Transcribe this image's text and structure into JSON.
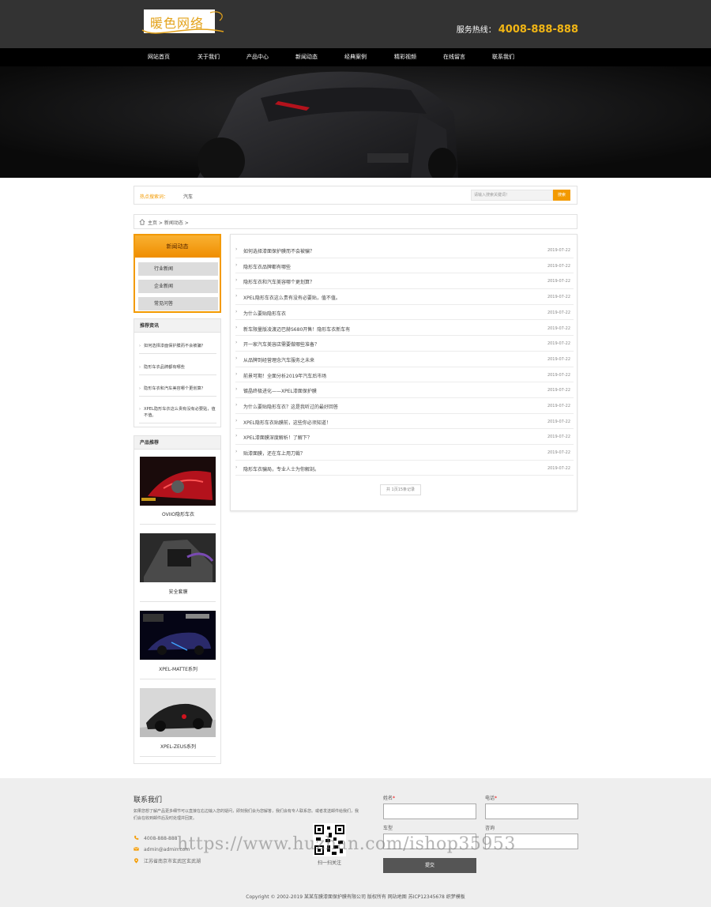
{
  "header": {
    "logo_text": "暖色网络",
    "hotline_label": "服务热线：",
    "hotline_number": "4008-888-888"
  },
  "nav": {
    "items": [
      "网站首页",
      "关于我们",
      "产品中心",
      "新闻动态",
      "经典案例",
      "精彩视频",
      "在线留言",
      "联系我们"
    ]
  },
  "hotsearch": {
    "label": "热点搜索词：",
    "word": "汽车",
    "placeholder": "请输入搜索关键词！",
    "button": "搜索"
  },
  "breadcrumb": {
    "text": "主页 > 新闻动态 >"
  },
  "sidebar": {
    "category_title": "新闻动态",
    "categories": [
      "行业新闻",
      "企业新闻",
      "常见问答"
    ],
    "recommend_title": "推荐资讯",
    "recommend_items": [
      "如何选择漆面保护膜而不会被骗？",
      "隐形车衣品牌都有哪些",
      "隐形车衣和汽车美容哪个更划算？",
      "XPEL隐形车衣这么贵有没有必要贴，值不值。"
    ],
    "product_title": "产品推荐",
    "products": [
      "OVIIO隐形车衣",
      "安全套膜",
      "XPEL-MATTE系列",
      "XPEL-ZEUS系列"
    ]
  },
  "news": {
    "items": [
      {
        "title": "如何选择漆面保护膜而不会被骗？",
        "date": "2019-07-22"
      },
      {
        "title": "隐形车衣品牌都有哪些",
        "date": "2019-07-22"
      },
      {
        "title": "隐形车衣和汽车美容哪个更划算？",
        "date": "2019-07-22"
      },
      {
        "title": "XPEL隐形车衣这么贵有没有必要贴，值不值。",
        "date": "2019-07-22"
      },
      {
        "title": "为什么要贴隐形车衣",
        "date": "2019-07-22"
      },
      {
        "title": "新车限量版凌渡迈巴赫S680开售！隐形车衣新车有",
        "date": "2019-07-22"
      },
      {
        "title": "开一家汽车美容店需要做哪些准备？",
        "date": "2019-07-22"
      },
      {
        "title": "从品牌到经营理念汽车服务之未来",
        "date": "2019-07-22"
      },
      {
        "title": "前景可期！全面分析2019年汽车后市场",
        "date": "2019-07-22"
      },
      {
        "title": "镀晶终极进化——XPEL漆面保护膜",
        "date": "2019-07-22"
      },
      {
        "title": "为什么要贴隐形车衣？这是我听过的最好回答",
        "date": "2019-07-22"
      },
      {
        "title": "XPEL隐形车衣贴膜前，这些你必须知道！",
        "date": "2019-07-22"
      },
      {
        "title": "XPEL漆面膜深度解析！了解下？",
        "date": "2019-07-22"
      },
      {
        "title": "贴漆面膜，还在车上用刀裁？",
        "date": "2019-07-22"
      },
      {
        "title": "隐形车衣骗局，专业人士为你解剖。",
        "date": "2019-07-22"
      }
    ],
    "pager": "共 1页15条记录"
  },
  "footer": {
    "title": "联系我们",
    "description": "如果您想了解产品更多细节可以直接在右边输入您的疑问，即刻我们会为您解答，我们会有专人联系您。或者发送邮件给我们，我们会在收到邮件后及时处理并回复。",
    "phone": "4008-888-888",
    "email": "admin@admin.com",
    "address": "江苏省南京市玄武区玄武湖",
    "qr_label": "扫一扫关注",
    "form": {
      "name_label": "姓名",
      "phone_label": "电话",
      "car_label": "车型",
      "consult_label": "咨询",
      "submit": "提交"
    },
    "copyright": "Copyright © 2002-2019 某某车膜漆面保护膜有限公司 版权所有    网站地图    苏ICP12345678    织梦模板"
  },
  "watermark": "https://www.huzhan.com/ishop35953",
  "colors": {
    "accent": "#f39a00",
    "topbar": "#333333",
    "nav": "#000000",
    "footer": "#eeeeee"
  }
}
